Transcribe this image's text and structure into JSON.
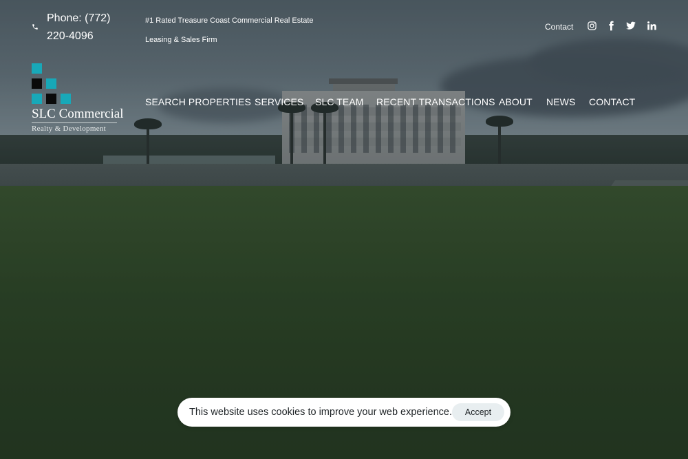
{
  "topbar": {
    "phone_icon": "phone-icon",
    "phone": "Phone: (772) 220-4096",
    "tagline": "#1 Rated Treasure Coast Commercial Real Estate Leasing & Sales Firm",
    "contact_link": "Contact",
    "social": [
      {
        "name": "instagram-icon"
      },
      {
        "name": "facebook-icon"
      },
      {
        "name": "twitter-icon"
      },
      {
        "name": "linkedin-icon"
      }
    ]
  },
  "logo": {
    "name": "SLC Commercial",
    "subtitle": "Realty & Development",
    "colors": {
      "teal": "#18a8b8",
      "black": "#0a0a0a"
    }
  },
  "nav": {
    "items": [
      {
        "label": "SEARCH PROPERTIES"
      },
      {
        "label": "SERVICES"
      },
      {
        "label": "SLC TEAM"
      },
      {
        "label": "RECENT TRANSACTIONS"
      },
      {
        "label": "ABOUT"
      },
      {
        "label": "NEWS"
      },
      {
        "label": "CONTACT"
      }
    ]
  },
  "cookie": {
    "message": "This website uses cookies to improve your web experience.",
    "accept_label": "Accept"
  }
}
